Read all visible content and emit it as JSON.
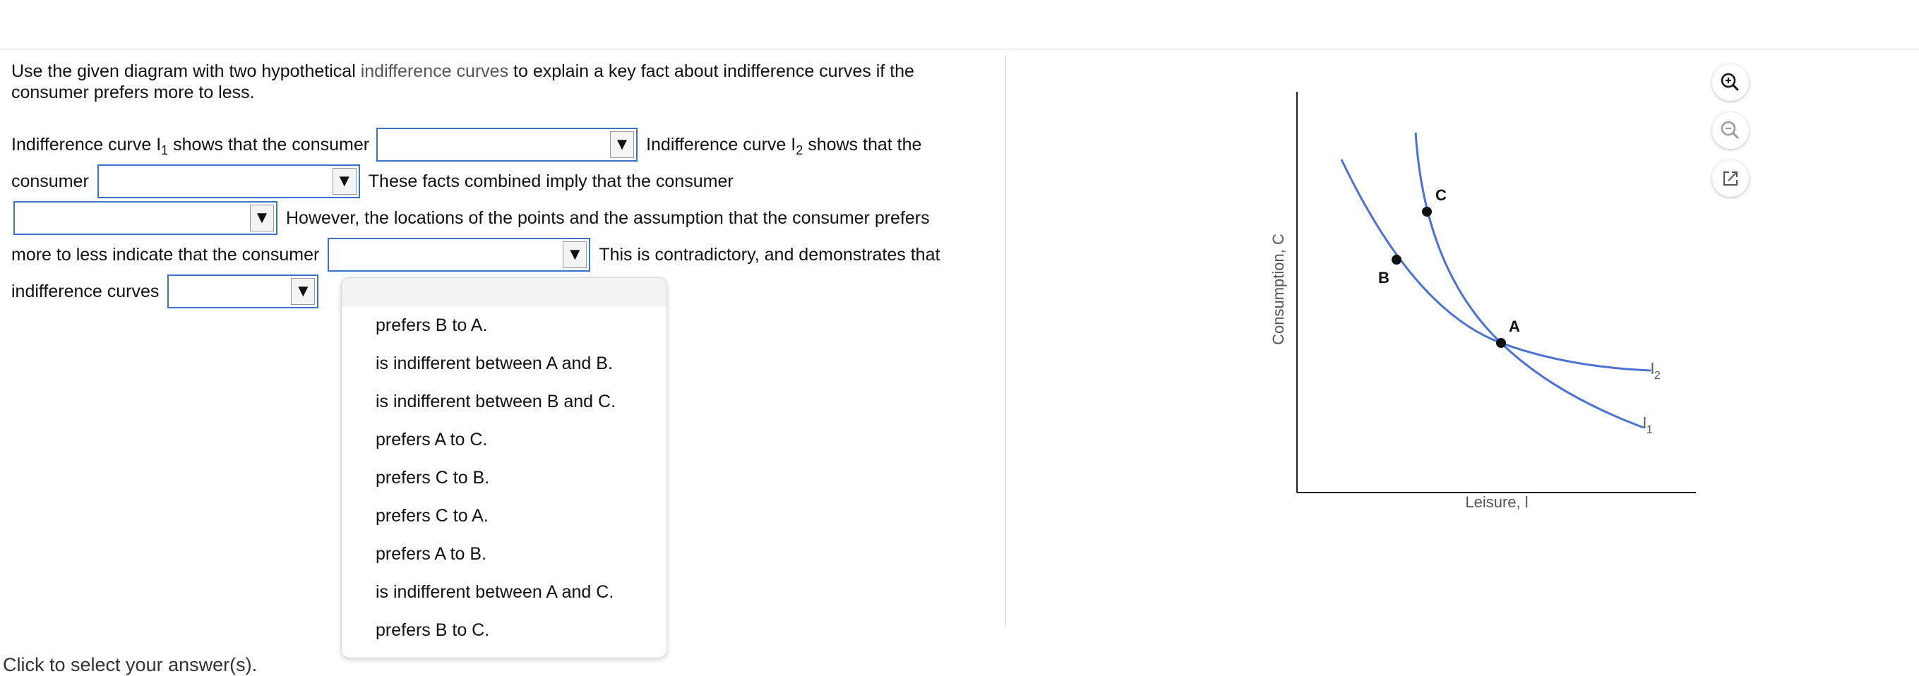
{
  "question": {
    "intro_before": "Use the given diagram with two hypothetical ",
    "intro_link": "indifference curves",
    "intro_after": " to explain a key fact about indifference curves if the consumer prefers more to less.",
    "t1_pre": "Indifference curve I",
    "t1_sub": "1",
    "t1_post": " shows that the consumer",
    "t2_pre": "Indifference curve I",
    "t2_sub": "2",
    "t2_post": " shows that the",
    "t3": "consumer",
    "t4": "These facts combined imply that the consumer",
    "t5": "However, the locations of the points and the assumption that the consumer prefers",
    "t6": "more to less indicate that the consumer",
    "t7": "This is contradictory, and demonstrates that",
    "t8": "indifference curves",
    "dropdown_arrow": "▼"
  },
  "dropdown_menu": {
    "options": [
      "prefers B to A.",
      "is indifferent between A and B.",
      "is indifferent between B and C.",
      "prefers A to C.",
      "prefers C to B.",
      "prefers C to A.",
      "prefers A to B.",
      "is indifferent between A and C.",
      "prefers B to C."
    ]
  },
  "footer_hint": "Click to select your answer(s).",
  "tools": [
    "zoom-in-icon",
    "zoom-out-icon",
    "popout-icon"
  ],
  "diagram": {
    "ylabel": "Consumption, C",
    "xlabel": "Leisure, l",
    "point_a": "A",
    "point_b": "B",
    "point_c": "C",
    "curve_1": "l",
    "curve_1_sub": "1",
    "curve_2": "l",
    "curve_2_sub": "2",
    "curve_color": "#4a72d4"
  }
}
